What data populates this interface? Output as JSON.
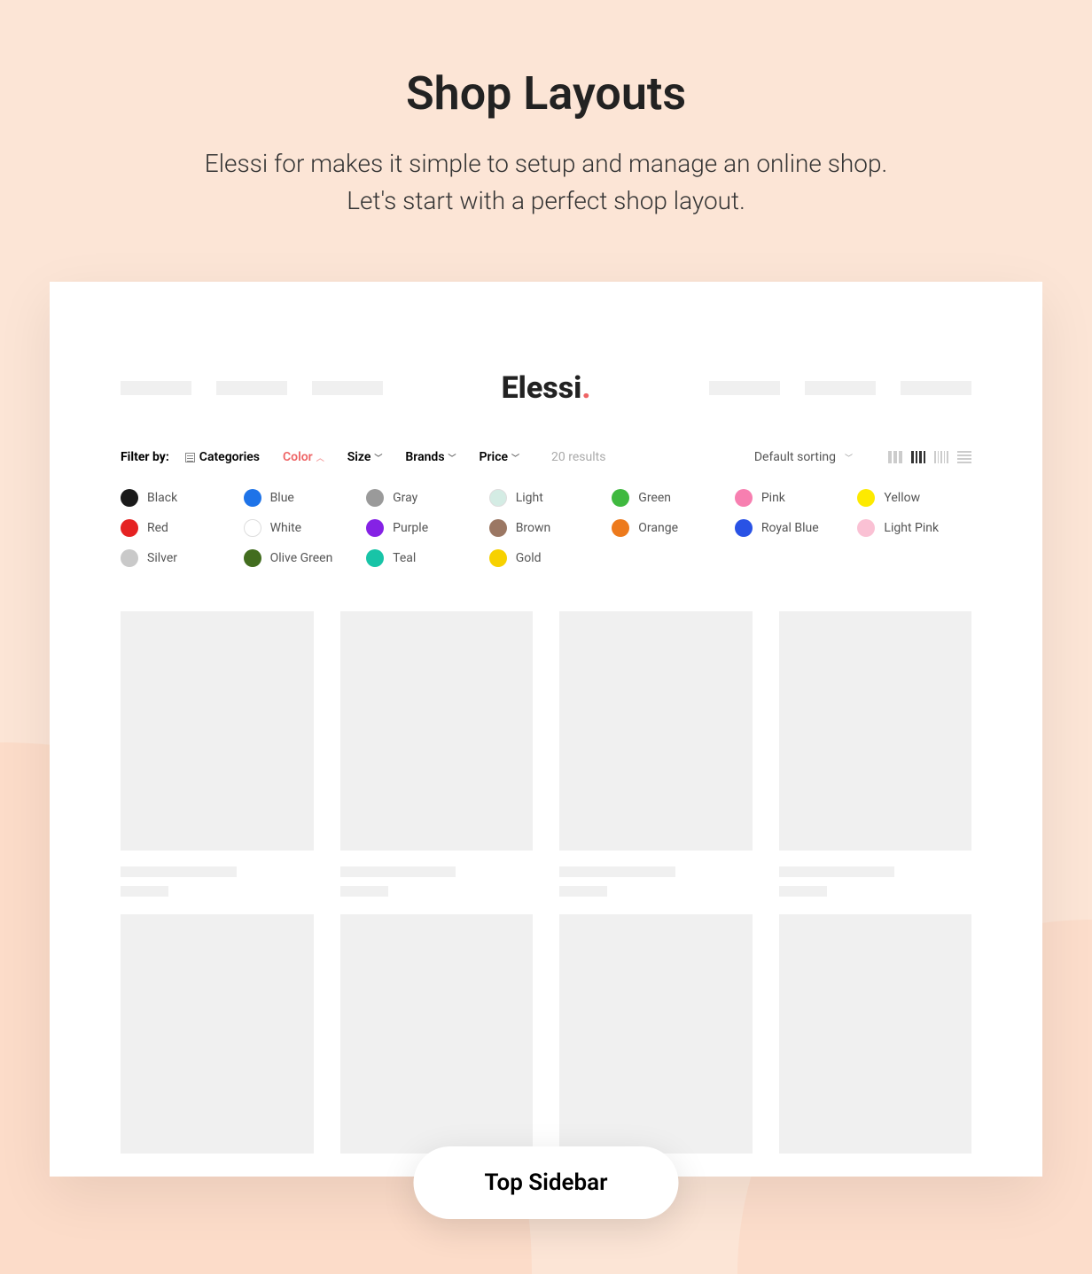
{
  "page": {
    "title": "Shop Layouts",
    "subtitle_line1": "Elessi for makes it simple to setup and manage an online shop.",
    "subtitle_line2": "Let's start with a perfect shop layout."
  },
  "logo": {
    "text": "Elessi",
    "dot": "."
  },
  "filter": {
    "label": "Filter by:",
    "categories": "Categories",
    "color": "Color",
    "size": "Size",
    "brands": "Brands",
    "price": "Price",
    "results": "20 results",
    "sort": "Default sorting"
  },
  "colors": [
    {
      "name": "Black",
      "hex": "#1a1a1a"
    },
    {
      "name": "Blue",
      "hex": "#1e73e8"
    },
    {
      "name": "Gray",
      "hex": "#9a9a9a"
    },
    {
      "name": "Light",
      "hex": "#d4ece4",
      "border": true
    },
    {
      "name": "Green",
      "hex": "#3fb93f"
    },
    {
      "name": "Pink",
      "hex": "#f77fb0"
    },
    {
      "name": "Yellow",
      "hex": "#fdea00"
    },
    {
      "name": "Red",
      "hex": "#e52222"
    },
    {
      "name": "White",
      "hex": "#ffffff",
      "border": true
    },
    {
      "name": "Purple",
      "hex": "#8522e5"
    },
    {
      "name": "Brown",
      "hex": "#9b7763"
    },
    {
      "name": "Orange",
      "hex": "#ed7a1c"
    },
    {
      "name": "Royal Blue",
      "hex": "#2952e5"
    },
    {
      "name": "Light Pink",
      "hex": "#fac1d4"
    },
    {
      "name": "Silver",
      "hex": "#c9c9c9"
    },
    {
      "name": "Olive Green",
      "hex": "#426d1f"
    },
    {
      "name": "Teal",
      "hex": "#18c4a7"
    },
    {
      "name": "Gold",
      "hex": "#f7d100"
    }
  ],
  "layout_button": "Top Sidebar"
}
